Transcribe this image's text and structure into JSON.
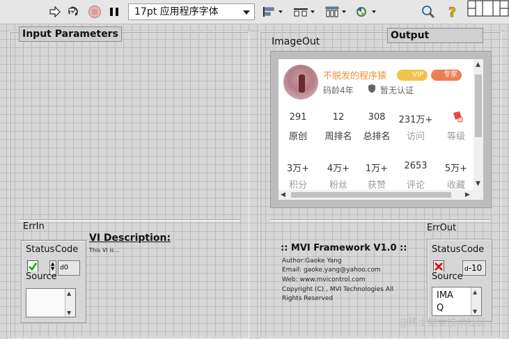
{
  "toolbar": {
    "font_select": "17pt 应用程序字体",
    "buttons": [
      "run-arrow-icon",
      "run-continuous-icon",
      "abort-icon",
      "pause-icon"
    ],
    "dropdowns": [
      "align-objects-icon",
      "distribute-objects-icon",
      "resize-objects-icon",
      "reorder-icon"
    ],
    "right": [
      "search-icon",
      "help-icon",
      "connector-pane-icon"
    ]
  },
  "panels": {
    "input_parameters": "Input Parameters",
    "output": "Output"
  },
  "image_out": {
    "label": "ImageOut",
    "profile": {
      "name": "不脱发的程序猿",
      "vip": "VIP",
      "pro": "专家",
      "age": "码龄4年",
      "cert": "暂无认证",
      "row1_values": [
        "291",
        "12",
        "308",
        "231万+",
        ""
      ],
      "row1_labels": [
        "原创",
        "周排名",
        "总排名",
        "访问",
        "等级"
      ],
      "row2_values": [
        "3万+",
        "4万+",
        "1万+",
        "2653",
        "5万+"
      ],
      "row2_labels": [
        "积分",
        "粉丝",
        "获赞",
        "评论",
        "收藏"
      ]
    }
  },
  "error_in": {
    "label": "ErrIn",
    "status": "Status",
    "code": "Code",
    "code_value": "0",
    "source": "Source",
    "status_ok": true
  },
  "vi_description": {
    "title": "VI Description:",
    "body": "This VI is .."
  },
  "mvi": {
    "title": ":: MVI Framework V1.0 ::",
    "author": "Author:Gaoke Yang",
    "email": "Email: gaoke.yang@yahoo.com",
    "web": "Web: www.mvicontrol.com",
    "copyright1": "Copyright (C) , MVI Technologies All",
    "copyright2": "Rights Reserved"
  },
  "error_out": {
    "label": "ErrOut",
    "status": "Status",
    "code": "Code",
    "code_value": "-10",
    "source": "Source",
    "source_value_l1": "IMA",
    "source_value_l2": "Q",
    "status_ok": false
  },
  "watermark": "@稀土掘金技术社区",
  "colors": {
    "accent_orange": "#e8923b",
    "ok_green": "#2bb32b",
    "err_red": "#d21c1c"
  }
}
